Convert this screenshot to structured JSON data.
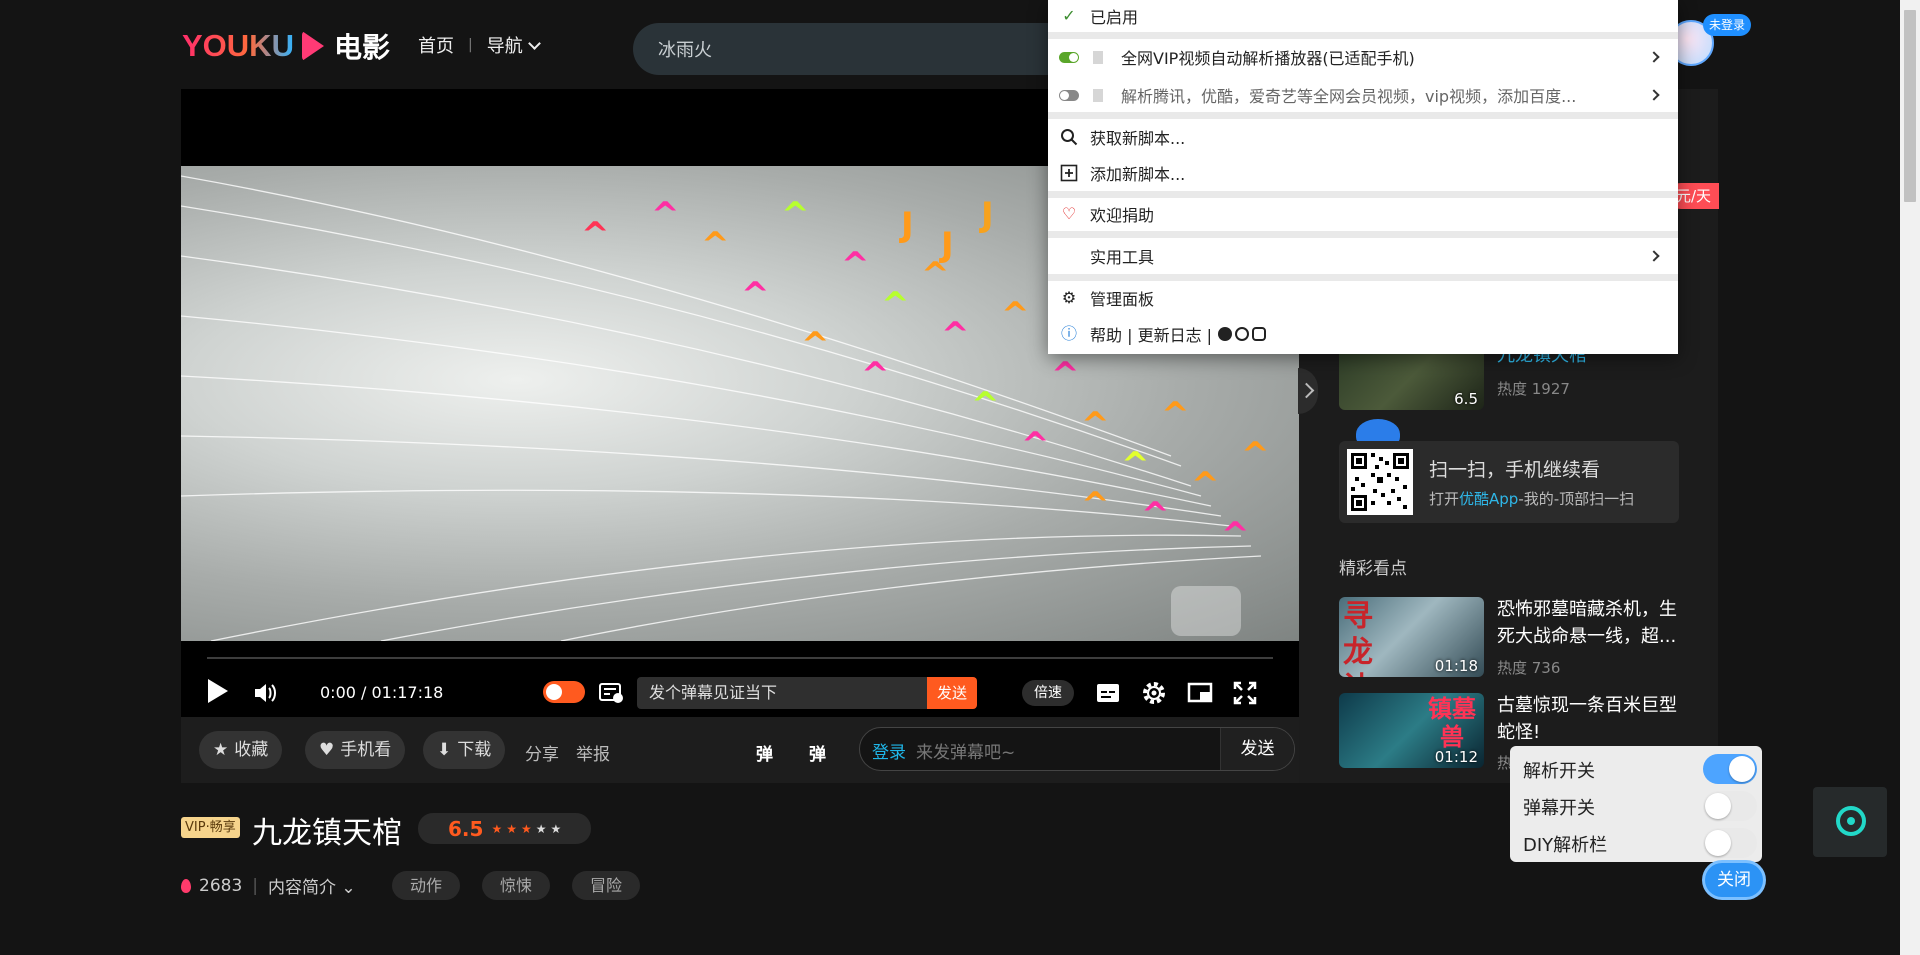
{
  "header": {
    "logo_text": "YOUKU",
    "logo_sub": "电影",
    "nav": {
      "home": "首页",
      "separator": "|",
      "navigation": "导航"
    },
    "search_value": "冰雨火",
    "avatar_badge": "未登录"
  },
  "player": {
    "time": "0:00 / 01:17:18",
    "danmu_placeholder": "发个弹幕见证当下",
    "danmu_send": "发送",
    "speed": "倍速",
    "actions": {
      "favorite": "收藏",
      "mobile": "手机看",
      "download": "下载",
      "share": "分享",
      "report": "举报",
      "danmu_icon_1": "弹",
      "danmu_icon_2": "弹"
    },
    "comment": {
      "login": "登录",
      "placeholder": "来发弹幕吧~",
      "send": "发送"
    }
  },
  "sidebar": {
    "vip_tag": "元/天",
    "featured": {
      "title": "九龙镇天棺",
      "heat": "热度 1927",
      "score": "6.5"
    },
    "qr": {
      "title": "扫一扫，手机继续看",
      "sub_prefix": "打开",
      "sub_app": "优酷App",
      "sub_suffix": "-我的-顶部扫一扫"
    },
    "section_title": "精彩看点",
    "items": [
      {
        "title": "恐怖邪墓暗藏杀机，生死大战命悬一线，超...",
        "heat": "热度 736",
        "duration": "01:18",
        "thumb_text": "寻龙诀"
      },
      {
        "title": "古墓惊现一条百米巨型蛇怪!",
        "heat": "热度",
        "duration": "01:12",
        "thumb_text": "镇墓兽"
      }
    ]
  },
  "movie": {
    "vip_badge": "VIP·畅享",
    "title": "九龙镇天棺",
    "score": "6.5",
    "rating_stars": 3,
    "heat": "2683",
    "intro": "内容简介",
    "tags": [
      "动作",
      "惊悚",
      "冒险"
    ]
  },
  "context_menu": {
    "enabled": "已启用",
    "script1": "全网VIP视频自动解析播放器(已适配手机)",
    "script2": "解析腾讯，优酷，爱奇艺等全网会员视频，vip视频，添加百度...",
    "get_scripts": "获取新脚本...",
    "add_script": "添加新脚本...",
    "donate": "欢迎捐助",
    "tools": "实用工具",
    "dashboard": "管理面板",
    "help": "帮助 | 更新日志 |"
  },
  "parse_panel": {
    "parse_switch": "解析开关",
    "danmu_switch": "弹幕开关",
    "diy_bar": "DIY解析栏",
    "parse_on": true,
    "danmu_on": false,
    "diy_on": false,
    "close": "关闭"
  },
  "colors": {
    "accent_orange": "#ff5a1f",
    "accent_blue": "#2c93f5",
    "teal": "#22d8c8"
  }
}
